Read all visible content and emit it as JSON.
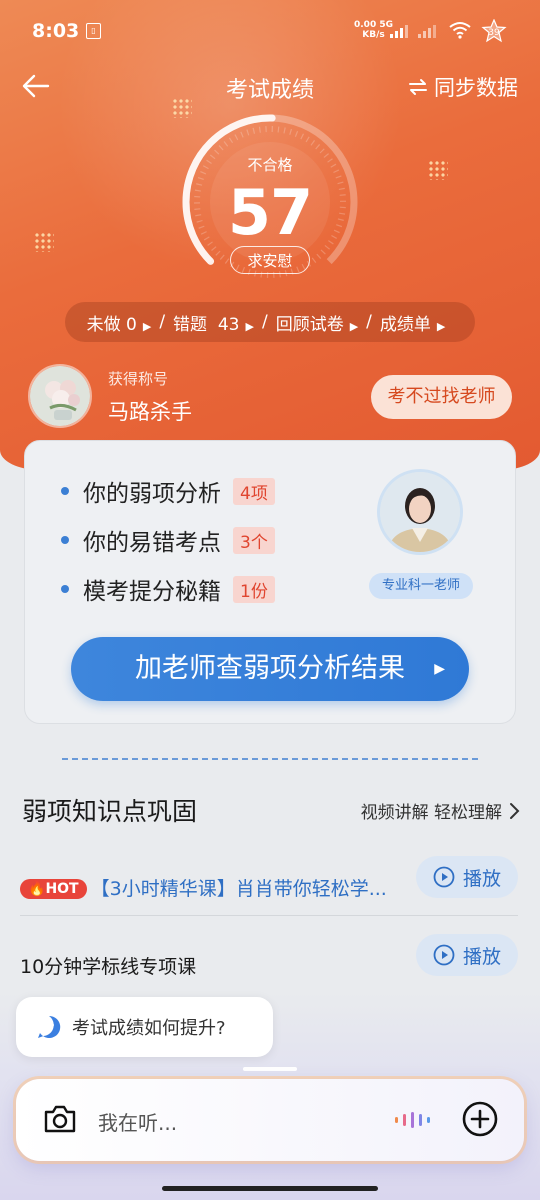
{
  "status_bar": {
    "time": "8:03",
    "net_speed": "0.00",
    "net_unit": "KB/s",
    "net_type": "5G",
    "battery": "39"
  },
  "header": {
    "title": "考试成绩",
    "sync_label": "同步数据"
  },
  "score": {
    "status": "不合格",
    "value": "57",
    "comfort_button": "求安慰"
  },
  "stats": {
    "undone_label": "未做",
    "undone_count": "0",
    "wrong_label": "错题",
    "wrong_count": "43",
    "review_label": "回顾试卷",
    "report_label": "成绩单"
  },
  "user": {
    "rank_label": "获得称号",
    "rank_title": "马路杀手",
    "find_teacher_button": "考不过找老师"
  },
  "analysis_card": {
    "items": [
      {
        "label": "你的弱项分析",
        "badge": "4项"
      },
      {
        "label": "你的易错考点",
        "badge": "3个"
      },
      {
        "label": "模考提分秘籍",
        "badge": "1份"
      }
    ],
    "teacher_tag": "专业科一老师",
    "cta_button": "加老师查弱项分析结果"
  },
  "weak_section": {
    "title": "弱项知识点巩固",
    "more_label": "视频讲解 轻松理解",
    "courses": [
      {
        "hot_label": "HOT",
        "title": "【3小时精华课】肖肖带你轻松学...",
        "play_label": "播放"
      },
      {
        "title": "10分钟学标线专项课",
        "play_label": "播放"
      }
    ]
  },
  "assistant": {
    "suggestion": "考试成绩如何提升?",
    "placeholder": "我在听..."
  },
  "colors": {
    "accent_orange": "#e9663a",
    "accent_blue": "#2f79d6",
    "badge_red": "#e0452f"
  },
  "icons": [
    "back-arrow-icon",
    "sync-icon",
    "chat-icon",
    "camera-icon",
    "voice-wave-icon",
    "plus-icon",
    "play-icon",
    "chevron-right-icon",
    "fire-icon"
  ]
}
